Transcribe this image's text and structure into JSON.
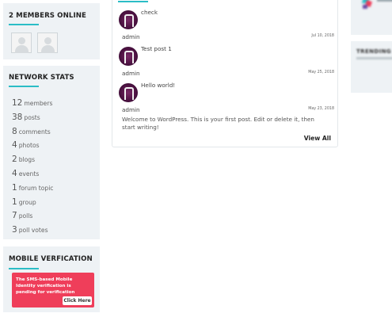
{
  "members_widget": {
    "title": "2 MEMBERS ONLINE",
    "avatars": [
      "member-avatar-1",
      "member-avatar-2"
    ]
  },
  "network_stats": {
    "title": "NETWORK STATS",
    "items": [
      {
        "count": "12",
        "label": "members"
      },
      {
        "count": "38",
        "label": "posts"
      },
      {
        "count": "8",
        "label": "comments"
      },
      {
        "count": "4",
        "label": "photos"
      },
      {
        "count": "2",
        "label": "blogs"
      },
      {
        "count": "4",
        "label": "events"
      },
      {
        "count": "1",
        "label": "forum topic"
      },
      {
        "count": "1",
        "label": "group"
      },
      {
        "count": "7",
        "label": "polls"
      },
      {
        "count": "3",
        "label": "poll votes"
      }
    ]
  },
  "mobile_widget": {
    "title": "MOBILE VERFICATION",
    "alert_text": "The SMS-based Mobile Identity verification is pending for verification",
    "button_label": "Click Here"
  },
  "activity": {
    "posts": [
      {
        "title": "check",
        "user": "admin",
        "date": "Jul 10, 2018",
        "content": ""
      },
      {
        "title": "Test post 1",
        "user": "admin",
        "date": "May 25, 2018",
        "content": ""
      },
      {
        "title": "Hello world!",
        "user": "admin",
        "date": "May 23, 2018",
        "content": "Welcome to WordPress. This is your first post. Edit or delete it, then start writing!"
      }
    ],
    "view_all_label": "View All"
  },
  "right_sidebar": {
    "widget2_title": "TRENDING"
  },
  "colors": {
    "accent": "#2bbdc6",
    "alert": "#ef3e5a",
    "widget_bg": "#eef2f5",
    "avatar": "#4a1140"
  }
}
